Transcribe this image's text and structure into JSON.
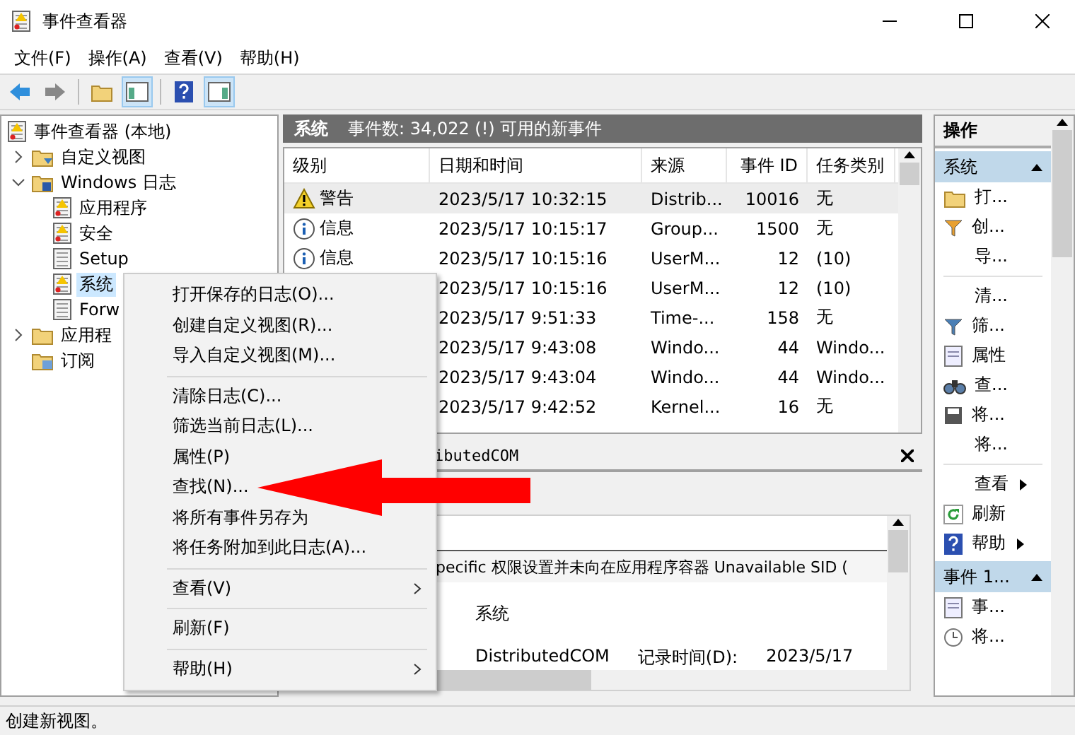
{
  "window": {
    "title": "事件查看器"
  },
  "menu": [
    "文件(F)",
    "操作(A)",
    "查看(V)",
    "帮助(H)"
  ],
  "tree": {
    "root": "事件查看器 (本地)",
    "items": [
      {
        "label": "自定义视图",
        "kind": "filter-folder",
        "expanded": false
      },
      {
        "label": "Windows 日志",
        "kind": "log-folder",
        "expanded": true,
        "children": [
          {
            "label": "应用程序",
            "kind": "log-alert",
            "selected": false
          },
          {
            "label": "安全",
            "kind": "log-alert",
            "selected": false
          },
          {
            "label": "Setup",
            "kind": "log",
            "selected": false
          },
          {
            "label": "系统",
            "kind": "log-alert",
            "selected": true
          },
          {
            "label": "Forw",
            "kind": "log",
            "selected": false
          }
        ]
      },
      {
        "label": "应用程",
        "kind": "folder",
        "expanded": false
      },
      {
        "label": "订阅",
        "kind": "subscription"
      }
    ]
  },
  "log_header": {
    "name": "系统",
    "summary": "事件数: 34,022 (!) 可用的新事件"
  },
  "table": {
    "columns": [
      "级别",
      "日期和时间",
      "来源",
      "事件 ID",
      "任务类别"
    ],
    "rows": [
      {
        "level": {
          "kind": "warning",
          "label": "警告"
        },
        "date": "2023/5/17 10:32:15",
        "source": "Distrib...",
        "id": "10016",
        "task": "无",
        "selected": true
      },
      {
        "level": {
          "kind": "info",
          "label": "信息"
        },
        "date": "2023/5/17 10:15:17",
        "source": "Group...",
        "id": "1500",
        "task": "无",
        "selected": false
      },
      {
        "level": {
          "kind": "info",
          "label": "信息"
        },
        "date": "2023/5/17 10:15:16",
        "source": "UserM...",
        "id": "12",
        "task": "(10)",
        "selected": false
      },
      {
        "date": "2023/5/17 10:15:16",
        "source": "UserM...",
        "id": "12",
        "task": "(10)",
        "selected": false
      },
      {
        "date": "2023/5/17 9:51:33",
        "source": "Time-...",
        "id": "158",
        "task": "无",
        "selected": false
      },
      {
        "date": "2023/5/17 9:43:08",
        "source": "Windo...",
        "id": "44",
        "task": "Windo...",
        "selected": false
      },
      {
        "date": "2023/5/17 9:43:04",
        "source": "Windo...",
        "id": "44",
        "task": "Windo...",
        "selected": false
      },
      {
        "date": "2023/5/17 9:42:52",
        "source": "Kernel...",
        "id": "16",
        "task": "无",
        "selected": false
      }
    ]
  },
  "detail": {
    "title": "ibutedCOM",
    "message": "pecific 权限设置并未向在应用程序容器 Unavailable SID (",
    "log_name": "系统",
    "source": "DistributedCOM",
    "logged_label": "记录时间(D):",
    "logged_value": "2023/5/17"
  },
  "actions": {
    "title": "操作",
    "sections": [
      {
        "title": "系统",
        "expanded": true,
        "items": [
          {
            "kind": "open",
            "label": "打..."
          },
          {
            "kind": "filter-new",
            "label": "创..."
          },
          {
            "kind": "plain",
            "label": "导..."
          },
          {
            "kind": "separator"
          },
          {
            "kind": "plain",
            "label": "清..."
          },
          {
            "kind": "filter",
            "label": "筛..."
          },
          {
            "kind": "properties",
            "label": "属性"
          },
          {
            "kind": "find",
            "label": "查..."
          },
          {
            "kind": "save",
            "label": "将..."
          },
          {
            "kind": "plain",
            "label": "将..."
          },
          {
            "kind": "separator"
          },
          {
            "kind": "plain",
            "label": "查看",
            "submenu": true
          },
          {
            "kind": "refresh",
            "label": "刷新"
          },
          {
            "kind": "help",
            "label": "帮助",
            "submenu": true
          }
        ]
      },
      {
        "title": "事件 1...",
        "expanded": true,
        "items": [
          {
            "kind": "event",
            "label": "事..."
          },
          {
            "kind": "task",
            "label": "将..."
          }
        ]
      }
    ]
  },
  "context_menu": [
    {
      "kind": "item",
      "label": "打开保存的日志(O)..."
    },
    {
      "kind": "item",
      "label": "创建自定义视图(R)..."
    },
    {
      "kind": "item",
      "label": "导入自定义视图(M)..."
    },
    {
      "kind": "separator"
    },
    {
      "kind": "item",
      "label": "清除日志(C)..."
    },
    {
      "kind": "item",
      "label": "筛选当前日志(L)..."
    },
    {
      "kind": "item",
      "label": "属性(P)"
    },
    {
      "kind": "item",
      "label": "查找(N)..."
    },
    {
      "kind": "item",
      "label": "将所有事件另存为"
    },
    {
      "kind": "item",
      "label": "将任务附加到此日志(A)..."
    },
    {
      "kind": "separator"
    },
    {
      "kind": "submenu",
      "label": "查看(V)"
    },
    {
      "kind": "separator"
    },
    {
      "kind": "item",
      "label": "刷新(F)"
    },
    {
      "kind": "separator"
    },
    {
      "kind": "submenu",
      "label": "帮助(H)"
    }
  ],
  "status_bar": "创建新视图。"
}
